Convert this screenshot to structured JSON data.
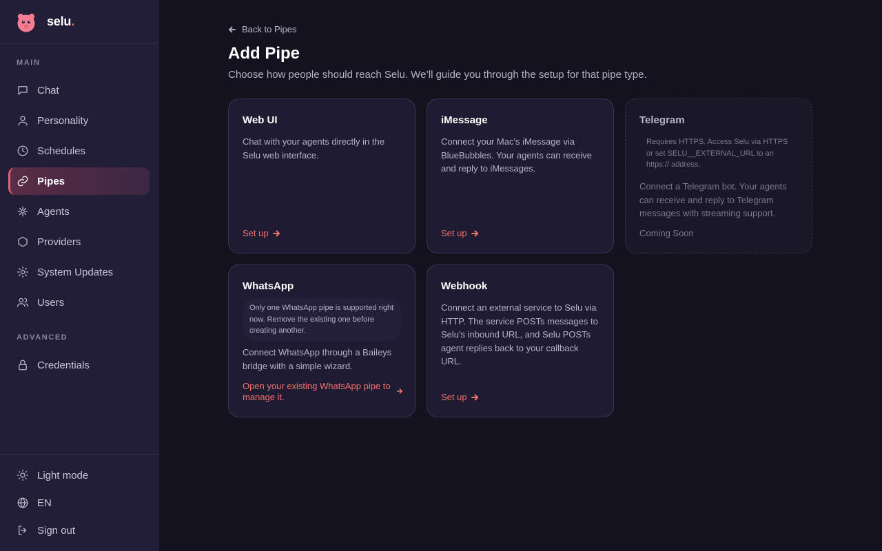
{
  "brand": {
    "name": "selu",
    "dot": "."
  },
  "sidebar": {
    "main_label": "MAIN",
    "advanced_label": "ADVANCED",
    "items": [
      {
        "label": "Chat",
        "icon": "chat-icon"
      },
      {
        "label": "Personality",
        "icon": "user-icon"
      },
      {
        "label": "Schedules",
        "icon": "clock-icon"
      },
      {
        "label": "Pipes",
        "icon": "link-icon",
        "active": true
      },
      {
        "label": "Agents",
        "icon": "agents-icon"
      },
      {
        "label": "Providers",
        "icon": "hexagon-icon"
      },
      {
        "label": "System Updates",
        "icon": "gear-icon"
      },
      {
        "label": "Users",
        "icon": "users-icon"
      }
    ],
    "advanced_items": [
      {
        "label": "Credentials",
        "icon": "lock-icon"
      }
    ],
    "footer": [
      {
        "label": "Light mode",
        "icon": "sun-icon"
      },
      {
        "label": "EN",
        "icon": "globe-icon"
      },
      {
        "label": "Sign out",
        "icon": "sign-out-icon"
      }
    ]
  },
  "main": {
    "back_label": "Back to Pipes",
    "title": "Add Pipe",
    "subtitle": "Choose how people should reach Selu. We’ll guide you through the setup for that pipe type."
  },
  "cards": {
    "webui": {
      "title": "Web UI",
      "description": "Chat with your agents directly in the Selu web interface.",
      "action": "Set up"
    },
    "imessage": {
      "title": "iMessage",
      "description": "Connect your Mac's iMessage via BlueBubbles. Your agents can receive and reply to iMessages.",
      "action": "Set up"
    },
    "telegram": {
      "title": "Telegram",
      "note": "Requires HTTPS. Access Selu via HTTPS or set SELU__EXTERNAL_URL to an https:// address.",
      "description": "Connect a Telegram bot. Your agents can receive and reply to Telegram messages with streaming support.",
      "status": "Coming Soon"
    },
    "whatsapp": {
      "title": "WhatsApp",
      "note": "Only one WhatsApp pipe is supported right now. Remove the existing one before creating another.",
      "description": "Connect WhatsApp through a Baileys bridge with a simple wizard.",
      "link": "Open your existing WhatsApp pipe to manage it."
    },
    "webhook": {
      "title": "Webhook",
      "description": "Connect an external service to Selu via HTTP. The service POSTs messages to Selu's inbound URL, and Selu POSTs agent replies back to your callback URL.",
      "action": "Set up"
    }
  },
  "colors": {
    "accent": "#f0736f",
    "background": "#15121f",
    "sidebar": "#221e37",
    "card": "#1f1b33"
  }
}
